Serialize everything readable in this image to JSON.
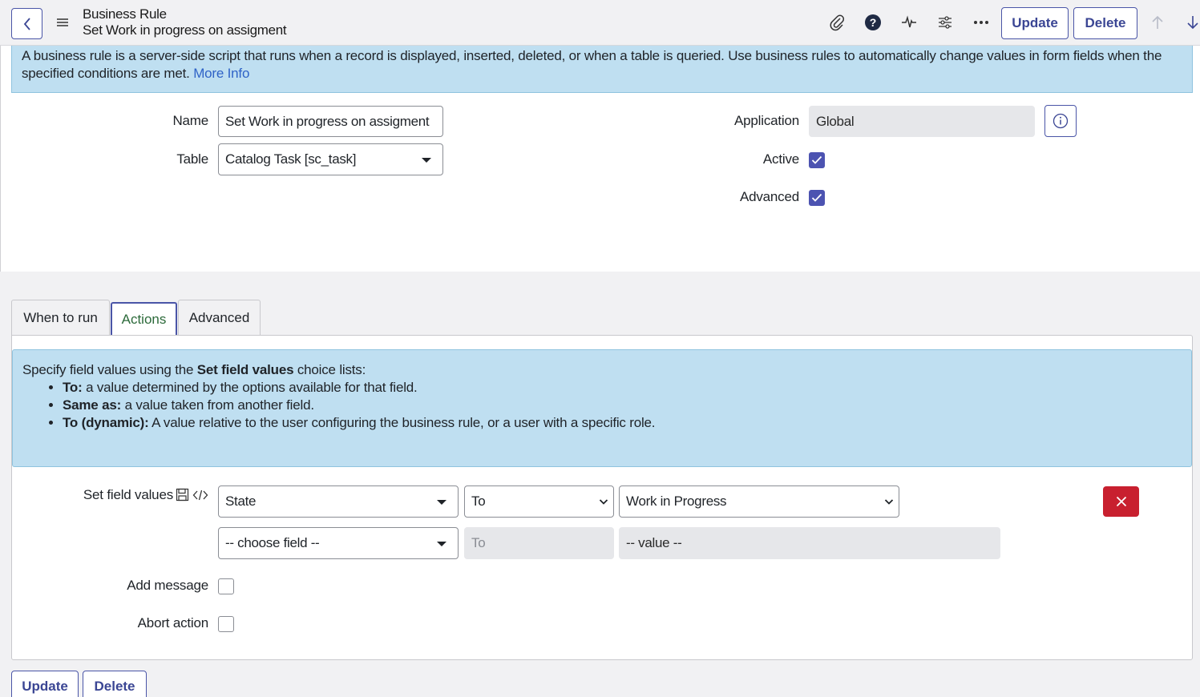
{
  "header": {
    "form_type": "Business Rule",
    "record_name": "Set Work in progress on assigment",
    "update_label": "Update",
    "delete_label": "Delete"
  },
  "banner": {
    "text": "A business rule is a server-side script that runs when a record is displayed, inserted, deleted, or when a table is queried. Use business rules to automatically change values in form fields when the specified conditions are met.",
    "link": "More Info"
  },
  "form": {
    "name_label": "Name",
    "name_value": "Set Work in progress on assigment",
    "table_label": "Table",
    "table_value": "Catalog Task [sc_task]",
    "application_label": "Application",
    "application_value": "Global",
    "active_label": "Active",
    "active_checked": true,
    "advanced_label": "Advanced",
    "advanced_checked": true
  },
  "tabs": [
    {
      "label": "When to run",
      "active": false
    },
    {
      "label": "Actions",
      "active": true
    },
    {
      "label": "Advanced",
      "active": false
    }
  ],
  "help": {
    "intro_pre": "Specify field values using the ",
    "intro_bold": "Set field values",
    "intro_post": " choice lists:",
    "items": [
      {
        "term": "To:",
        "desc": " a value determined by the options available for that field."
      },
      {
        "term": "Same as:",
        "desc": " a value taken from another field."
      },
      {
        "term": "To (dynamic):",
        "desc": " A value relative to the user configuring the business rule, or a user with a specific role."
      }
    ]
  },
  "set_field_values": {
    "label": "Set field values",
    "row1": {
      "field": "State",
      "operator": "To",
      "value": "Work in Progress"
    },
    "row2": {
      "field": "-- choose field --",
      "operator": "To",
      "value": "-- value --"
    }
  },
  "options": {
    "add_message_label": "Add message",
    "add_message_checked": false,
    "abort_action_label": "Abort action",
    "abort_action_checked": false
  },
  "footer": {
    "update_label": "Update",
    "delete_label": "Delete"
  },
  "colors": {
    "accent": "#4a55a7",
    "banner": "#bfdff1",
    "danger": "#c8202f"
  }
}
